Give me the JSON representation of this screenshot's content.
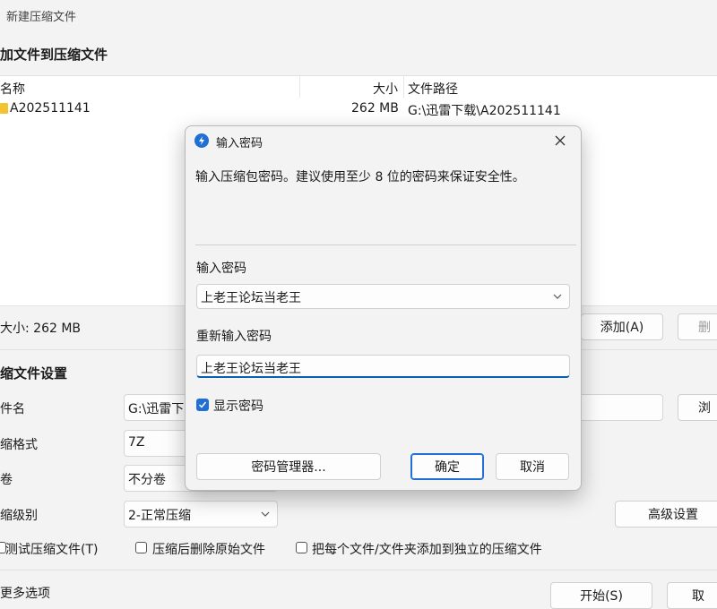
{
  "window": {
    "title": "新建压缩文件",
    "add_files_section": "加文件到压缩文件",
    "columns": {
      "name": "名称",
      "size": "大小",
      "path": "文件路径"
    },
    "files": [
      {
        "name": "A202511141",
        "size": "262 MB",
        "path": "G:\\迅雷下载\\A202511141"
      }
    ],
    "total_size": "大小: 262 MB",
    "add_button": "添加(A)",
    "delete_button": "删",
    "settings_section": "缩文件设置",
    "filename_label": "件名",
    "filename_value": "G:\\迅雷下",
    "browse_button": "浏",
    "format_label": "缩格式",
    "format_value": "7Z",
    "volume_label": "卷",
    "volume_value": "不分卷",
    "level_label": "缩级别",
    "level_value": "2-正常压缩",
    "advanced_button": "高级设置",
    "test_checkbox": "测试压缩文件(T)",
    "delete_after_checkbox": "压缩后删除原始文件",
    "each_separate_checkbox": "把每个文件/文件夹添加到独立的压缩文件",
    "more_options": "更多选项",
    "start_button": "开始(S)",
    "cancel_button": "取"
  },
  "dialog": {
    "title": "输入密码",
    "description": "输入压缩包密码。建议使用至少 8 位的密码来保证安全性。",
    "password_label": "输入密码",
    "password_value": "上老王论坛当老王",
    "reenter_label": "重新输入密码",
    "reenter_value": "上老王论坛当老王",
    "show_password_label": "显示密码",
    "show_password_checked": true,
    "manager_button": "密码管理器...",
    "ok_button": "确定",
    "cancel_button": "取消"
  },
  "colors": {
    "accent": "#1f6fd6",
    "folder": "#f4c430"
  }
}
